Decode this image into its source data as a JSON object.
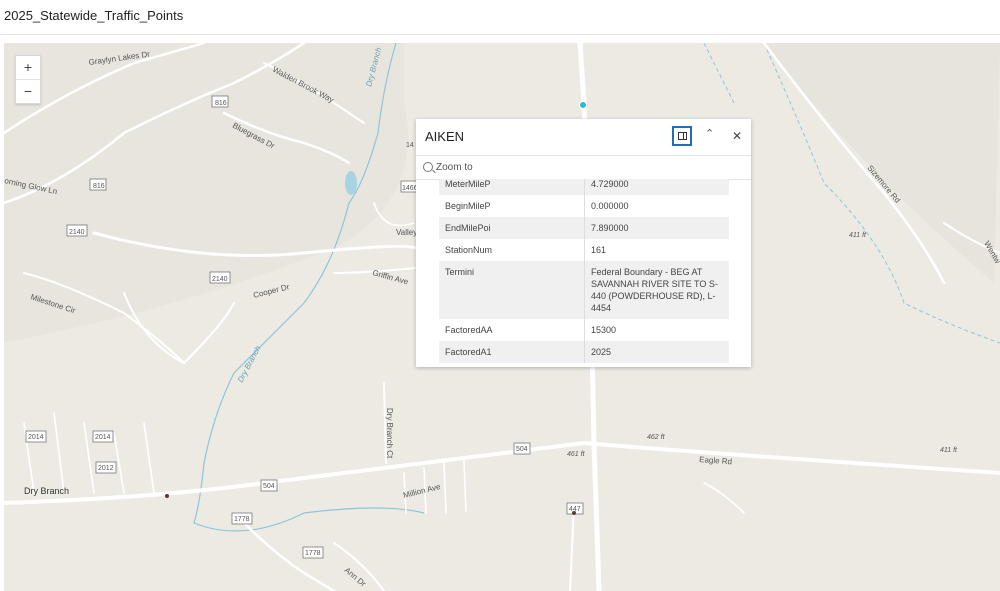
{
  "app": {
    "title": "2025_Statewide_Traffic_Points"
  },
  "zoom": {
    "in_label": "+",
    "out_label": "−"
  },
  "popup": {
    "title": "AIKEN",
    "zoom_to": "Zoom to",
    "icons": {
      "dock": "dock-panel-icon",
      "collapse": "chevron-up-icon",
      "close": "close-icon"
    },
    "rows": [
      {
        "key": "MeterMileP",
        "value": "4.729000"
      },
      {
        "key": "BeginMileP",
        "value": "0.000000"
      },
      {
        "key": "EndMilePoi",
        "value": "7.890000"
      },
      {
        "key": "StationNum",
        "value": "161"
      },
      {
        "key": "Termini",
        "value": "Federal Boundary - BEG AT SAVANNAH RIVER SITE TO S-440 (POWDERHOUSE RD), L-4454"
      },
      {
        "key": "FactoredAA",
        "value": "15300"
      },
      {
        "key": "FactoredA1",
        "value": "2025"
      }
    ]
  },
  "map": {
    "colors": {
      "land": "#eceae3",
      "road": "#ffffff",
      "water": "#8cc6d8",
      "point": "#2bbbd4"
    },
    "labels": {
      "graylyn_lakes": "Graylyn Lakes Dr",
      "walden_brook": "Walden Brook Way",
      "dry_branch_creek": "Dry Branch",
      "r816a": "816",
      "bluegrass": "Bluegrass Dr",
      "r816b": "816",
      "morning_glow": "orning Glow Ln",
      "r2140a": "2140",
      "r2140b": "2140",
      "r1466": "1466",
      "r14": "14",
      "valley": "Valley",
      "griffin": "Griffin Ave",
      "cooper": "Cooper Dr",
      "milestone": "Milestone Cir",
      "dry_branch_creek2": "Dry Branch",
      "dry_branch_ct": "Dry Branch Ct",
      "r2014a": "2014",
      "r2014b": "2014",
      "r2012": "2012",
      "dry_branch_town": "Dry Branch",
      "r504a": "504",
      "r504b": "504",
      "million": "Million Ave",
      "r1778a": "1778",
      "r1778b": "1778",
      "ann": "Ann Dr",
      "r447": "447",
      "eagle": "Eagle Rd",
      "sizemore": "Sizemore Rd",
      "wentw": "Wentw",
      "e411a": "411 ft",
      "e461": "461 ft",
      "e462": "462 ft",
      "e411b": "411 ft"
    }
  }
}
